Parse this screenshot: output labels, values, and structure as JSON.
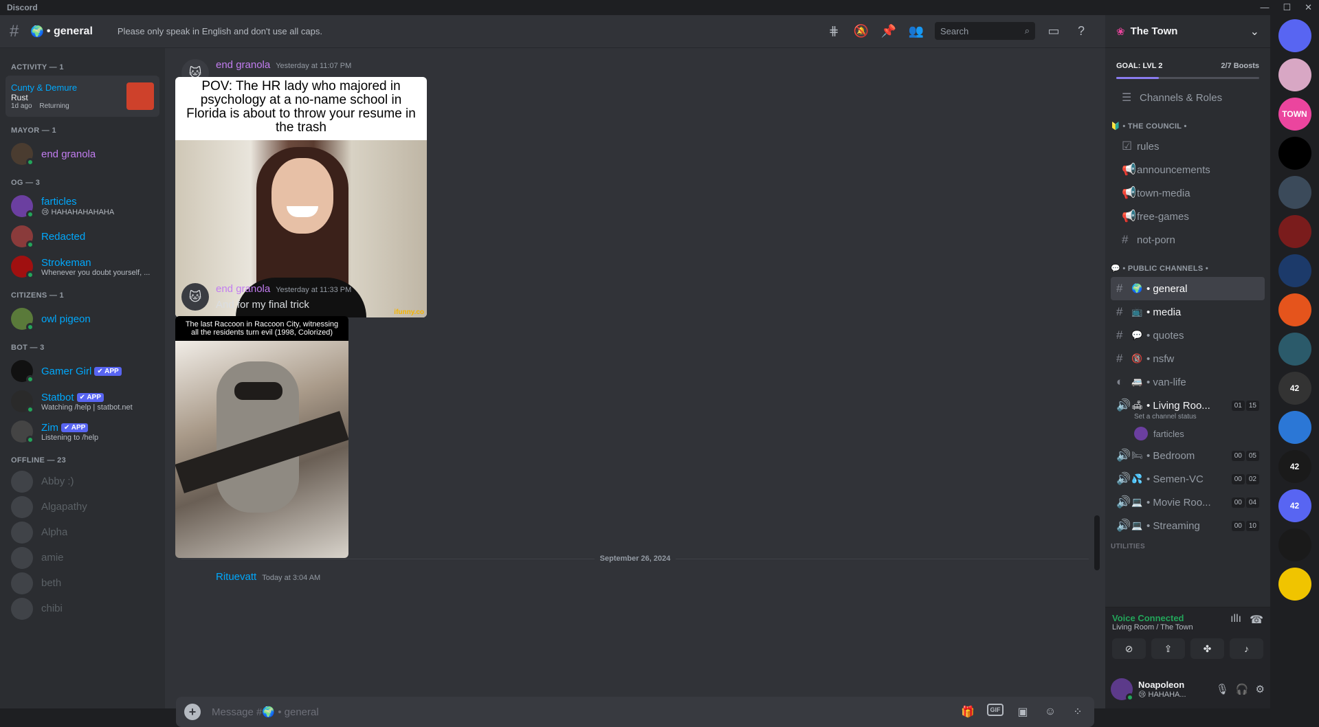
{
  "window": {
    "title": "Discord",
    "controls": [
      "—",
      "☐",
      "✕"
    ]
  },
  "topbar": {
    "channel_emoji": "🌍",
    "channel_name": "• general",
    "topic": "Please only speak in English and don't use all caps.",
    "search_placeholder": "Search"
  },
  "members": {
    "activity_header": "ACTIVITY — 1",
    "activity": {
      "name": "Cunty & Demure",
      "game": "Rust",
      "time": "1d ago",
      "state": "Returning"
    },
    "groups": [
      {
        "header": "MAYOR — 1",
        "members": [
          {
            "name": "end granola",
            "sub": "",
            "color": "#c27df0",
            "avatar_bg": "#4a3c30"
          }
        ]
      },
      {
        "header": "OG — 3",
        "members": [
          {
            "name": "farticles",
            "sub": "😢 HAHAHAHAHAHA",
            "color": "#00a8fc",
            "avatar_bg": "#6b3fa0"
          },
          {
            "name": "Redacted",
            "sub": "",
            "color": "#00a8fc",
            "avatar_bg": "#8a3b3b"
          },
          {
            "name": "Strokeman",
            "sub": "Whenever you doubt yourself, ...",
            "color": "#00a8fc",
            "avatar_bg": "#a01010"
          }
        ]
      },
      {
        "header": "CITIZENS — 1",
        "members": [
          {
            "name": "owl pigeon",
            "sub": "",
            "color": "#00a8fc",
            "avatar_bg": "#5a7a3a"
          }
        ]
      },
      {
        "header": "BOT — 3",
        "members": [
          {
            "name": "Gamer Girl",
            "sub": "",
            "color": "#00a8fc",
            "avatar_bg": "#111111",
            "badge": "✔ APP"
          },
          {
            "name": "Statbot",
            "sub": "Watching /help | statbot.net",
            "color": "#00a8fc",
            "avatar_bg": "#2a2a2a",
            "badge": "✔ APP"
          },
          {
            "name": "Zim",
            "sub": "Listening to /help",
            "color": "#00a8fc",
            "avatar_bg": "#444444",
            "badge": "✔ APP"
          }
        ]
      }
    ],
    "offline_header": "OFFLINE — 23",
    "offline": [
      "Abby :)",
      "Algapathy",
      "Alpha",
      "amie",
      "beth",
      "chibi"
    ]
  },
  "messages": [
    {
      "author": "end granola",
      "time": "Yesterday at 11:07 PM",
      "text": "",
      "image_caption": "POV: The HR lady who majored in psychology at a no-name school in Florida is about to throw your resume in the trash",
      "watermark": "ifunny.co"
    },
    {
      "author": "end granola",
      "time": "Yesterday at 11:33 PM",
      "text": "And for my final trick",
      "image_caption": "The last Raccoon in Raccoon City, witnessing all the residents turn evil (1998, Colorized)"
    }
  ],
  "date_divider": "September 26, 2024",
  "partial_message": {
    "author": "Rituevatt",
    "time": "Today at 3:04 AM"
  },
  "composer": {
    "placeholder": "Message #🌍 • general"
  },
  "server": {
    "name": "The Town",
    "goal": "GOAL: LVL 2",
    "boosts": "2/7 Boosts",
    "boost_progress": 0.3,
    "channels_roles": "Channels & Roles",
    "council_header": "🔰 • THE COUNCIL •",
    "council": [
      "rules",
      "announcements",
      "town-media",
      "free-games",
      "not-porn"
    ],
    "public_header": "💬 • PUBLIC CHANNELS •",
    "public": [
      {
        "emoji": "🌍",
        "name": "• general"
      },
      {
        "emoji": "📺",
        "name": "• media"
      },
      {
        "emoji": "💬",
        "name": "• quotes"
      },
      {
        "emoji": "🔞",
        "name": "• nsfw"
      },
      {
        "emoji": "🚐",
        "name": "• van-life"
      }
    ],
    "voice": [
      {
        "emoji": "🛋",
        "name": "• Living Roo...",
        "a": "01",
        "b": "15"
      },
      {
        "emoji": "🛏",
        "name": "• Bedroom",
        "a": "00",
        "b": "05"
      },
      {
        "emoji": "💦",
        "name": "• Semen-VC",
        "a": "00",
        "b": "02"
      },
      {
        "emoji": "💻",
        "name": "• Movie Roo...",
        "a": "00",
        "b": "04"
      },
      {
        "emoji": "💻",
        "name": "• Streaming",
        "a": "00",
        "b": "10"
      }
    ],
    "channel_status": "Set a channel status",
    "voice_member": "farticles",
    "utilities": "UTILITIES",
    "voice_connected": "Voice Connected",
    "voice_location": "Living Room / The Town",
    "user": {
      "name": "Noapoleon",
      "status": "😢 HAHAHA..."
    }
  },
  "guilds": [
    "",
    "",
    "TOWN",
    "",
    "",
    "",
    "",
    "",
    "",
    "42",
    "",
    "42",
    "42",
    "",
    ""
  ]
}
